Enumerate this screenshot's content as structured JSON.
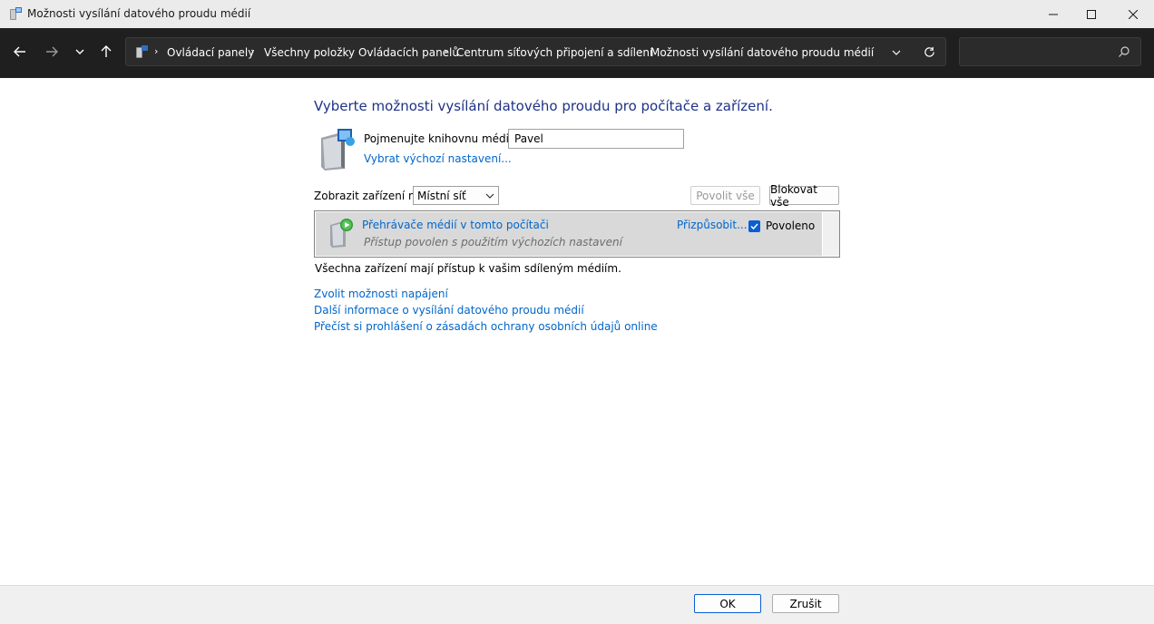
{
  "window": {
    "title": "Možnosti vysílání datového proudu médií"
  },
  "navigation": {
    "breadcrumbs": [
      "Ovládací panely",
      "Všechny položky Ovládacích panelů",
      "Centrum síťových připojení a sdílení",
      "Možnosti vysílání datového proudu médií"
    ],
    "search_placeholder": ""
  },
  "main": {
    "heading": "Vyberte možnosti vysílání datového proudu pro počítače a zařízení.",
    "library_name_label": "Pojmenujte knihovnu médií:",
    "library_name_value": "Pavel",
    "defaults_link": "Vybrat výchozí nastavení...",
    "show_devices_label": "Zobrazit zařízení na:",
    "show_devices_value": "Místní síť",
    "allow_all_label": "Povolit vše",
    "block_all_label": "Blokovat vše",
    "device": {
      "name": "Přehrávače médií v tomto počítači",
      "status": "Přístup povolen s použitím výchozích nastavení",
      "customize_link": "Přizpůsobit...",
      "allowed_label": "Povoleno",
      "allowed": true
    },
    "summary": "Všechna zařízení mají přístup k vašim sdíleným médiím.",
    "links": [
      "Zvolit možnosti napájení",
      "Další informace o vysílání datového proudu médií",
      "Přečíst si prohlášení o zásadách ochrany osobních údajů online"
    ]
  },
  "footer": {
    "ok_label": "OK",
    "cancel_label": "Zrušit"
  },
  "colors": {
    "heading": "#1e3287",
    "link": "#0066cc",
    "navbar_bg": "#1f1f1f",
    "accent": "#0a5fd1"
  }
}
